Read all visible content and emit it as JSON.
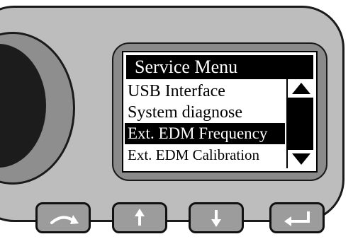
{
  "screen": {
    "title": "Service Menu",
    "items": [
      {
        "label": "USB Interface",
        "selected": false
      },
      {
        "label": "System diagnose",
        "selected": false
      },
      {
        "label": "Ext. EDM Frequency",
        "selected": true
      },
      {
        "label": "Ext. EDM Calibration",
        "selected": false
      }
    ]
  },
  "keys": [
    {
      "icon": "curved-arrow-icon"
    },
    {
      "icon": "arrow-up-icon"
    },
    {
      "icon": "arrow-down-icon"
    },
    {
      "icon": "enter-icon"
    }
  ],
  "colors": {
    "housing": "#bdbdbd",
    "bezel": "#8a8a8a",
    "screen": "#ffffff",
    "highlight": "#000000"
  }
}
